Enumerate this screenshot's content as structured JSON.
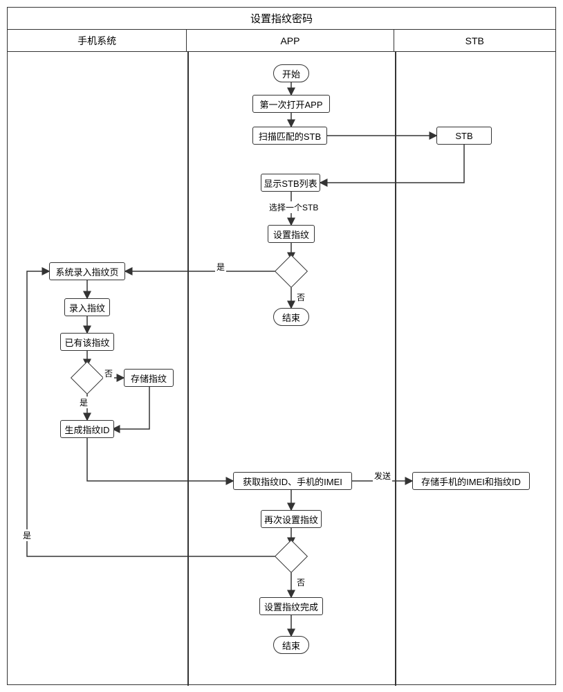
{
  "title": "设置指纹密码",
  "lanes": {
    "phone": "手机系统",
    "app": "APP",
    "stb": "STB"
  },
  "app": {
    "start": "开始",
    "first_open": "第一次打开APP",
    "scan_stb": "扫描匹配的STB",
    "show_list": "显示STB列表",
    "select_one": "选择一个STB",
    "set_fp": "设置指纹",
    "end1": "结束",
    "get_ids": "获取指纹ID、手机的IMEI",
    "set_again": "再次设置指纹",
    "done": "设置指纹完成",
    "end2": "结束"
  },
  "phone": {
    "sys_page": "系统录入指纹页",
    "input_fp": "录入指纹",
    "has_fp": "已有该指纹",
    "store_fp": "存储指纹",
    "gen_id": "生成指纹ID"
  },
  "stb": {
    "stb_box": "STB",
    "store_ids": "存储手机的IMEI和指纹ID"
  },
  "labels": {
    "yes": "是",
    "no": "否",
    "send": "发送"
  }
}
